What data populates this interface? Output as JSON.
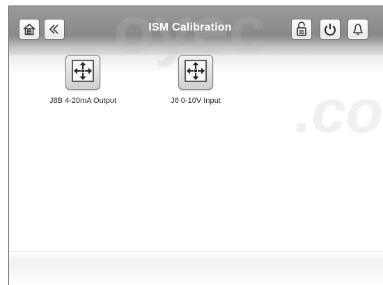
{
  "header": {
    "title": "ISM Calibration"
  },
  "toolbar": {
    "left": [
      {
        "icon": "home-icon"
      },
      {
        "icon": "back-chevron-icon"
      }
    ],
    "right": [
      {
        "icon": "unlock-icon"
      },
      {
        "icon": "power-icon"
      },
      {
        "icon": "bell-icon"
      }
    ]
  },
  "tiles": [
    {
      "label": "J8B 4-20mA Output",
      "icon": "calibrate-arrows-icon"
    },
    {
      "label": "J6 0-10V Input",
      "icon": "calibrate-arrows-icon"
    }
  ]
}
